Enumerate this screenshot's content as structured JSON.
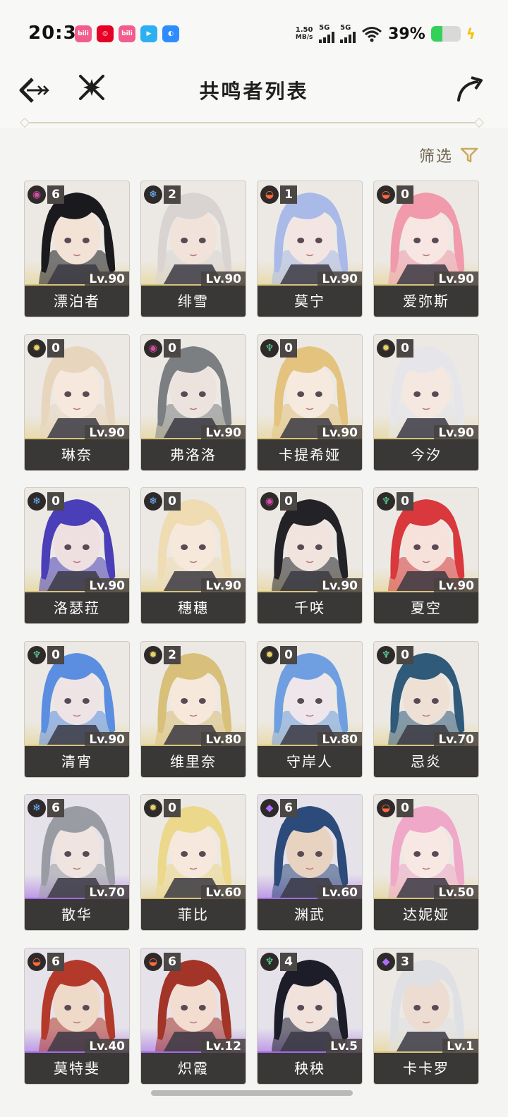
{
  "status_bar": {
    "time": "20:31",
    "apps": [
      {
        "icon": "bilibili-icon",
        "color": "#f25d8e",
        "label": "bili"
      },
      {
        "icon": "netease-music-icon",
        "color": "#e60026",
        "label": "◎"
      },
      {
        "icon": "bilibili-icon",
        "color": "#f25d8e",
        "label": "bili"
      },
      {
        "icon": "play-icon",
        "color": "#2db0f0",
        "label": "▶"
      },
      {
        "icon": "browser-icon",
        "color": "#2f8cff",
        "label": "◐"
      }
    ],
    "net_speed_value": "1.50",
    "net_speed_unit": "MB/s",
    "signal1": "5G",
    "signal2": "5G",
    "battery_pct": "39%",
    "battery_level": 0.39
  },
  "header": {
    "title": "共鸣者列表"
  },
  "filter": {
    "label": "筛选"
  },
  "colors": {
    "gold": "#d9c37a",
    "purple": "#a46be3",
    "havoc": "#d54ba6",
    "glacio": "#6fb3ff",
    "fusion": "#ff6a3d",
    "spectro": "#e8d36a",
    "aero": "#5fe0a0",
    "electro": "#b06bff"
  },
  "characters": [
    {
      "name": "漂泊者",
      "level": "Lv.90",
      "cons": "6",
      "element": "havoc",
      "rarity": 5,
      "hair": "#1a1a1e",
      "skin": "#f3e3d6"
    },
    {
      "name": "绯雪",
      "level": "Lv.90",
      "cons": "2",
      "element": "glacio",
      "rarity": 5,
      "hair": "#d9d4d2",
      "skin": "#f1e3da"
    },
    {
      "name": "莫宁",
      "level": "Lv.90",
      "cons": "1",
      "element": "fusion",
      "rarity": 5,
      "hair": "#a9b9e8",
      "skin": "#f3e6e2"
    },
    {
      "name": "爱弥斯",
      "level": "Lv.90",
      "cons": "0",
      "element": "fusion",
      "rarity": 5,
      "hair": "#f09aac",
      "skin": "#f7e6e2"
    },
    {
      "name": "琳奈",
      "level": "Lv.90",
      "cons": "0",
      "element": "spectro",
      "rarity": 5,
      "hair": "#e8d5bd",
      "skin": "#f6e8dd"
    },
    {
      "name": "弗洛洛",
      "level": "Lv.90",
      "cons": "0",
      "element": "havoc",
      "rarity": 5,
      "hair": "#7b7f82",
      "skin": "#ece3df"
    },
    {
      "name": "卡提希娅",
      "level": "Lv.90",
      "cons": "0",
      "element": "aero",
      "rarity": 5,
      "hair": "#e3c37e",
      "skin": "#f6e9de"
    },
    {
      "name": "今汐",
      "level": "Lv.90",
      "cons": "0",
      "element": "spectro",
      "rarity": 5,
      "hair": "#e6e6ea",
      "skin": "#f5e8e0"
    },
    {
      "name": "洛瑟菈",
      "level": "Lv.90",
      "cons": "0",
      "element": "glacio",
      "rarity": 5,
      "hair": "#4a3fb8",
      "skin": "#eedfe0"
    },
    {
      "name": "穗穗",
      "level": "Lv.90",
      "cons": "0",
      "element": "glacio",
      "rarity": 5,
      "hair": "#efdcb3",
      "skin": "#f6e9dc"
    },
    {
      "name": "千咲",
      "level": "Lv.90",
      "cons": "0",
      "element": "havoc",
      "rarity": 5,
      "hair": "#232226",
      "skin": "#f1e4de"
    },
    {
      "name": "夏空",
      "level": "Lv.90",
      "cons": "0",
      "element": "aero",
      "rarity": 5,
      "hair": "#d9383d",
      "skin": "#f6e2da"
    },
    {
      "name": "清宵",
      "level": "Lv.90",
      "cons": "0",
      "element": "aero",
      "rarity": 5,
      "hair": "#5b8ee0",
      "skin": "#eee4e6"
    },
    {
      "name": "维里奈",
      "level": "Lv.80",
      "cons": "2",
      "element": "spectro",
      "rarity": 5,
      "hair": "#d8c07a",
      "skin": "#f7e8dc"
    },
    {
      "name": "守岸人",
      "level": "Lv.80",
      "cons": "0",
      "element": "spectro",
      "rarity": 5,
      "hair": "#6f9fe0",
      "skin": "#eee6ea"
    },
    {
      "name": "忌炎",
      "level": "Lv.70",
      "cons": "0",
      "element": "aero",
      "rarity": 5,
      "hair": "#2f5a7a",
      "skin": "#efe0d6"
    },
    {
      "name": "散华",
      "level": "Lv.70",
      "cons": "6",
      "element": "glacio",
      "rarity": 4,
      "hair": "#9a9ca3",
      "skin": "#f0e4e0"
    },
    {
      "name": "菲比",
      "level": "Lv.60",
      "cons": "0",
      "element": "spectro",
      "rarity": 5,
      "hair": "#ecd88a",
      "skin": "#f6e8dc"
    },
    {
      "name": "渊武",
      "level": "Lv.60",
      "cons": "6",
      "element": "electro",
      "rarity": 4,
      "hair": "#2c4a7a",
      "skin": "#e8d2c0"
    },
    {
      "name": "达妮娅",
      "level": "Lv.50",
      "cons": "0",
      "element": "fusion",
      "rarity": 5,
      "hair": "#f0a8c8",
      "skin": "#f7e8e4"
    },
    {
      "name": "莫特斐",
      "level": "Lv.40",
      "cons": "6",
      "element": "fusion",
      "rarity": 4,
      "hair": "#b33a2a",
      "skin": "#efd9c8"
    },
    {
      "name": "炽霞",
      "level": "Lv.12",
      "cons": "6",
      "element": "fusion",
      "rarity": 4,
      "hair": "#a33428",
      "skin": "#f2ddd0"
    },
    {
      "name": "秧秧",
      "level": "Lv.5",
      "cons": "4",
      "element": "aero",
      "rarity": 4,
      "hair": "#1c1d28",
      "skin": "#f1e3dc"
    },
    {
      "name": "卡卡罗",
      "level": "Lv.1",
      "cons": "3",
      "element": "electro",
      "rarity": 5,
      "hair": "#dfe0e4",
      "skin": "#ecdcd2"
    }
  ]
}
